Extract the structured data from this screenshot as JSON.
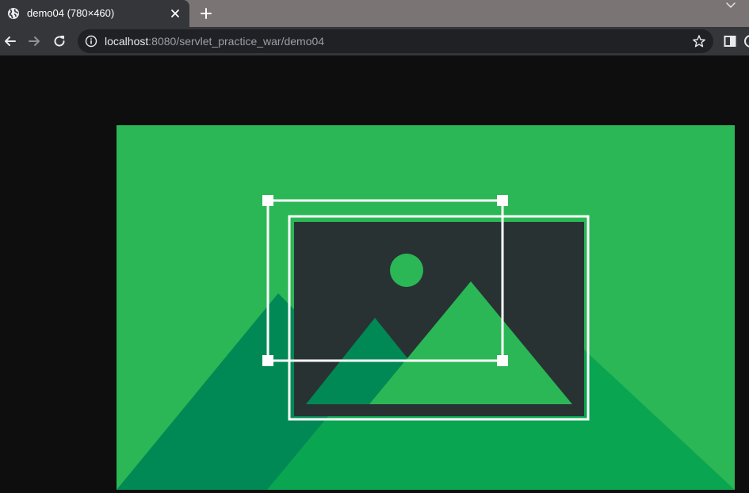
{
  "browser": {
    "tab": {
      "title": "demo04 (780×460)",
      "favicon": "globe-icon"
    },
    "address_bar": {
      "host": "localhost",
      "path": ":8080/servlet_practice_war/demo04"
    },
    "icons": {
      "back": "arrow-left-icon",
      "forward": "arrow-right-icon",
      "reload": "reload-icon",
      "info": "info-icon",
      "bookmark": "star-icon",
      "side_panel": "side-panel-icon",
      "new_tab": "plus-icon",
      "close_tab": "close-icon",
      "tab_search": "chevron-down-icon"
    }
  },
  "page": {
    "image": {
      "alt_icon": "image-placeholder-icon",
      "colors": {
        "background": "#2bb756",
        "mountain_dark": "#018955",
        "mountain_mid": "#0aa551",
        "frame": "#283233",
        "accent": "#2bb756",
        "selection": "#ffffff"
      }
    }
  }
}
